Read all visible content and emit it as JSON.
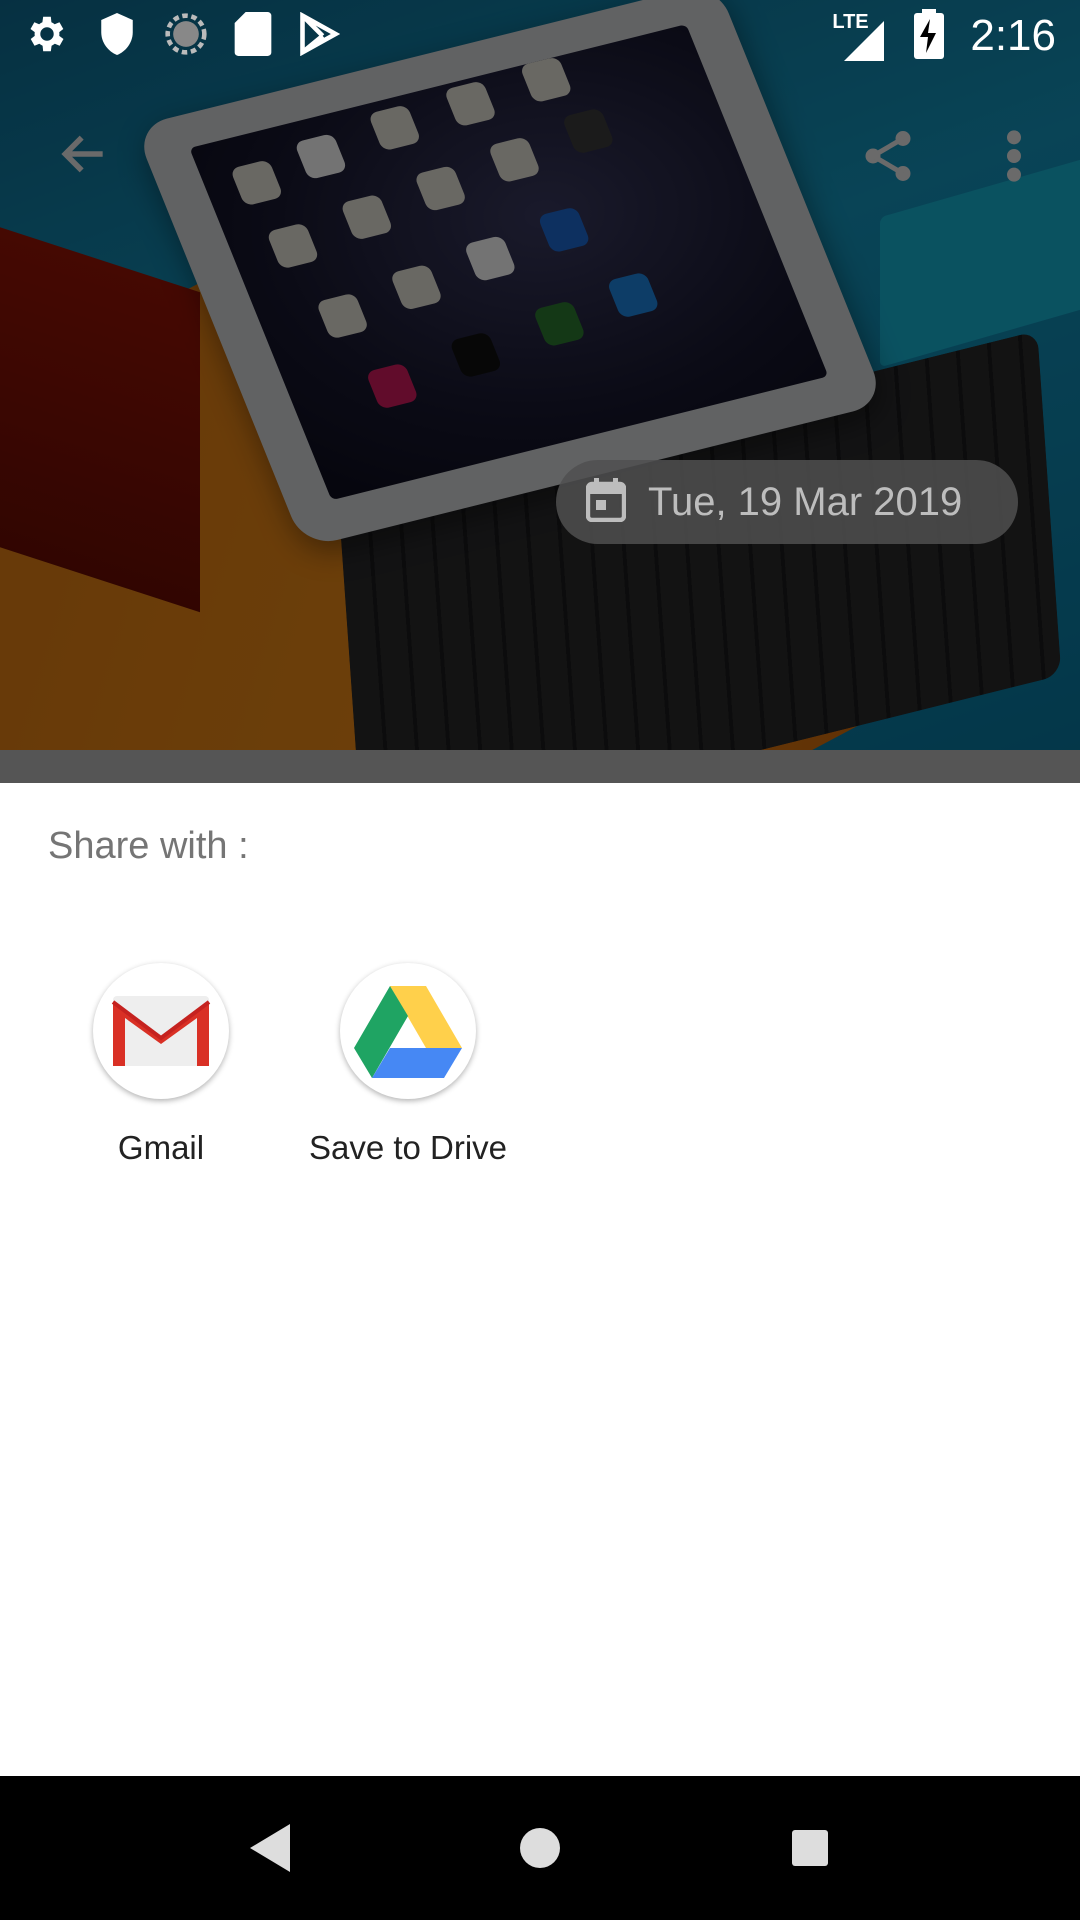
{
  "status_bar": {
    "time": "2:16",
    "network": "LTE",
    "left_icons": [
      "gear-icon",
      "shield-icon",
      "sync-icon",
      "sd-card-icon",
      "play-store-icon"
    ],
    "right_icons": [
      "lte-signal-icon",
      "battery-charging-icon"
    ]
  },
  "toolbar": {
    "back_icon": "arrow-back-icon",
    "share_icon": "share-icon",
    "more_icon": "more-vert-icon"
  },
  "date_chip": {
    "icon": "calendar-icon",
    "text": "Tue, 19 Mar 2019"
  },
  "share_sheet": {
    "title": "Share with :",
    "apps": [
      {
        "label": "Gmail",
        "icon": "gmail-icon"
      },
      {
        "label": "Save to Drive",
        "icon": "google-drive-icon"
      }
    ]
  },
  "nav_bar": {
    "buttons": [
      "nav-back-icon",
      "nav-home-icon",
      "nav-recents-icon"
    ]
  },
  "colors": {
    "sheet_background": "#ffffff",
    "title_text": "#757575",
    "gmail_red": "#d93025",
    "drive_green": "#1fa463",
    "drive_yellow": "#ffd04b",
    "drive_blue": "#4688f4"
  }
}
